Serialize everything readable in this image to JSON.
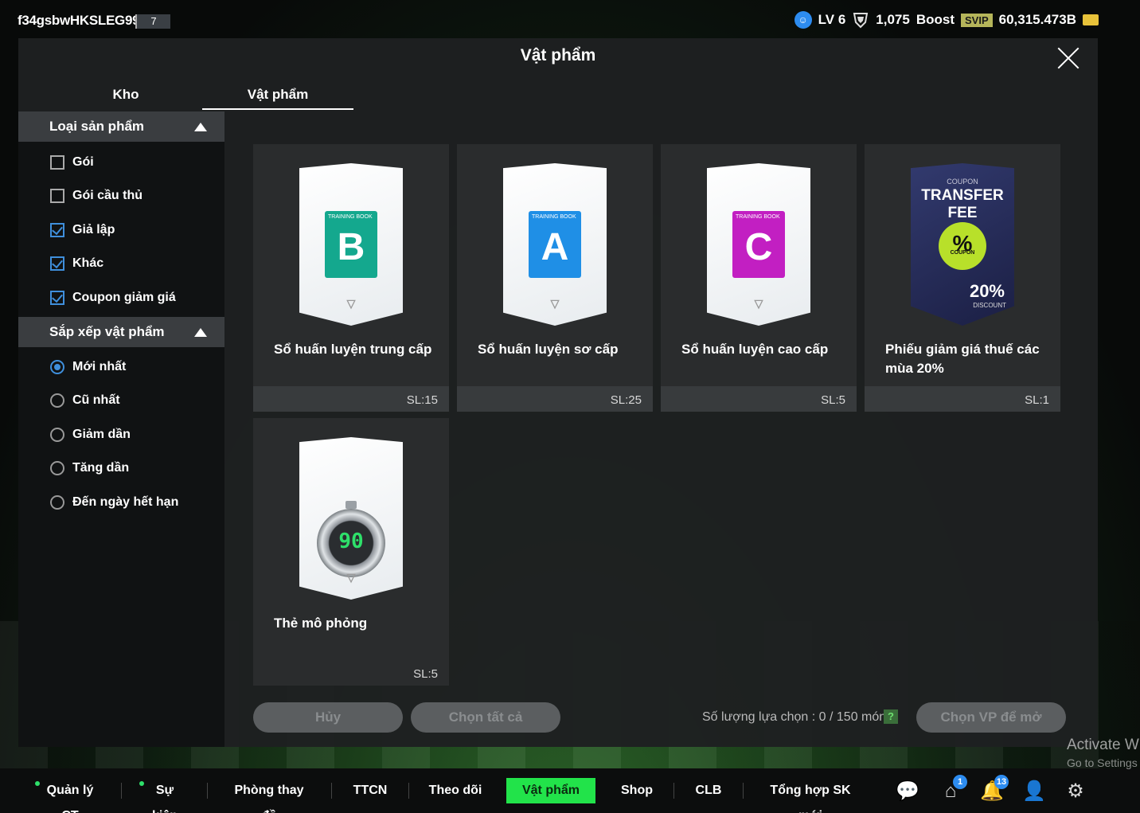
{
  "topbar": {
    "username": "f34gsbwHKSLEG99",
    "user_level": "7",
    "lv_label": "LV 6",
    "rank_value": "1,075",
    "boost_label": "Boost",
    "svip_label": "SVIP",
    "coins": "60,315.473B"
  },
  "modal": {
    "title": "Vật phẩm",
    "tabs": [
      {
        "label": "Kho"
      },
      {
        "label": "Vật phẩm"
      }
    ]
  },
  "sidebar": {
    "category": {
      "title": "Loại sản phẩm",
      "options": [
        {
          "label": "Gói",
          "checked": false
        },
        {
          "label": "Gói cầu thủ",
          "checked": false
        },
        {
          "label": "Giả lập",
          "checked": true
        },
        {
          "label": "Khác",
          "checked": true
        },
        {
          "label": "Coupon giảm giá",
          "checked": true
        }
      ]
    },
    "sort": {
      "title": "Sắp xếp vật phẩm",
      "options": [
        {
          "label": "Mới nhất",
          "selected": true
        },
        {
          "label": "Cũ nhất",
          "selected": false
        },
        {
          "label": "Giảm dần",
          "selected": false
        },
        {
          "label": "Tăng dần",
          "selected": false
        },
        {
          "label": "Đến ngày hết hạn",
          "selected": false
        }
      ]
    }
  },
  "items": [
    {
      "name": "Sổ huấn luyện trung cấp",
      "qty": "SL:15",
      "book_title": "TRAINING BOOK",
      "letter": "B",
      "color": "#14a88e"
    },
    {
      "name": "Sổ huấn luyện sơ cấp",
      "qty": "SL:25",
      "book_title": "TRAINING BOOK",
      "letter": "A",
      "color": "#1f8fe6"
    },
    {
      "name": "Sổ huấn luyện cao cấp",
      "qty": "SL:5",
      "book_title": "TRAINING BOOK",
      "letter": "C",
      "color": "#c21fc2"
    },
    {
      "name": "Phiếu giảm giá thuế các mùa 20%",
      "qty": "SL:1",
      "coupon_top": "COUPON",
      "coupon_title": "TRANSFER FEE",
      "coupon_badge": "%",
      "coupon_badge_sub": "COUPON",
      "discount": "20%",
      "discount_label": "DISCOUNT"
    },
    {
      "name": "Thẻ mô phỏng",
      "qty": "SL:5",
      "timer": "90"
    }
  ],
  "actions": {
    "cancel": "Hủy",
    "select_all": "Chọn tất cả",
    "selection_count": "Số lượng lựa chọn : 0 / 150 món",
    "help": "?",
    "open": "Chọn VP để mở"
  },
  "bottom_nav": {
    "items": [
      {
        "label": "Quản lý CT"
      },
      {
        "label": "Sự kiện"
      },
      {
        "label": "Phòng thay đồ"
      },
      {
        "label": "TTCN"
      },
      {
        "label": "Theo dõi"
      },
      {
        "label": "Vật phẩm"
      },
      {
        "label": "Shop"
      },
      {
        "label": "CLB"
      },
      {
        "label": "Tổng hợp SK mới"
      }
    ],
    "badges": {
      "home": "1",
      "bell": "13"
    },
    "active_color": "#22e34a"
  },
  "watermark": {
    "line1": "Activate W",
    "line2": "Go to Settings"
  }
}
